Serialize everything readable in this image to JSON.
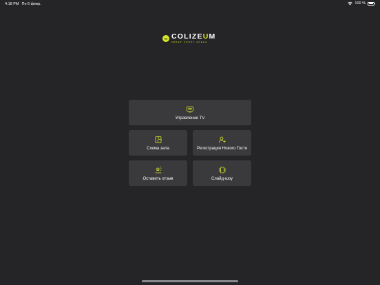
{
  "status_bar": {
    "time": "4:18 PM",
    "date": "Пн 6 февр.",
    "battery": "100 %",
    "battery_level": 1.0,
    "wifi_icon": "wifi-icon",
    "battery_icon": "battery-icon"
  },
  "logo": {
    "badge_text": "CZ",
    "name_part1": "COLIZE",
    "name_accent": "U",
    "name_part2": "M",
    "tagline": "КИБЕР СПОРТ АРЕНА"
  },
  "menu": {
    "tv": {
      "label": "Управление TV",
      "icon": "tv-icon"
    },
    "hall": {
      "label": "Схема зала",
      "icon": "map-icon"
    },
    "guest": {
      "label": "Регистрация Нового Гостя",
      "icon": "add-user-icon"
    },
    "review": {
      "label": "Оставить отзыв",
      "icon": "review-icon"
    },
    "slides": {
      "label": "Слайд-шоу",
      "icon": "slideshow-icon"
    }
  },
  "colors": {
    "background": "#252528",
    "tile": "#3a3a3d",
    "accent": "#d6e52a"
  }
}
